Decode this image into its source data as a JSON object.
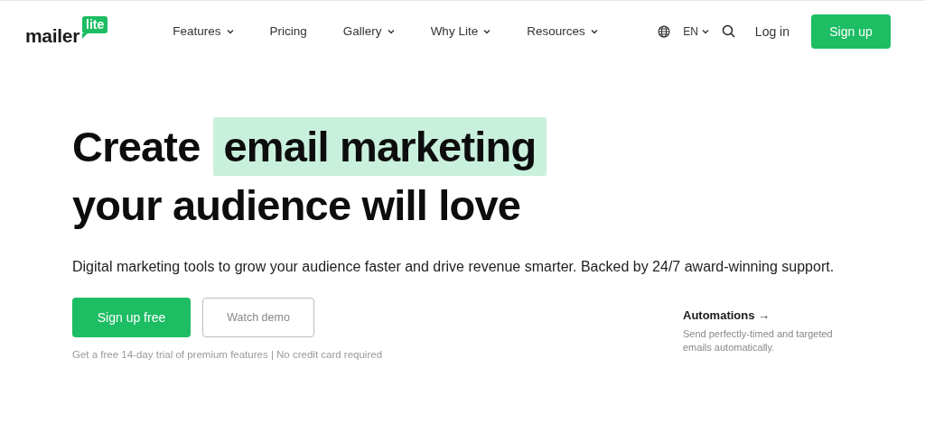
{
  "header": {
    "logo": {
      "word": "mailer",
      "badge": "lite"
    },
    "nav": [
      {
        "label": "Features",
        "has_menu": true
      },
      {
        "label": "Pricing",
        "has_menu": false
      },
      {
        "label": "Gallery",
        "has_menu": true
      },
      {
        "label": "Why Lite",
        "has_menu": true
      },
      {
        "label": "Resources",
        "has_menu": true
      }
    ],
    "language": "EN",
    "login": "Log in",
    "signup": "Sign up"
  },
  "hero": {
    "title_lines": [
      [
        {
          "text": "Create",
          "highlighted": false
        },
        {
          "text": "email marketing",
          "highlighted": true
        }
      ],
      [
        {
          "text": "your audience will love",
          "highlighted": false
        }
      ]
    ],
    "subtitle": "Digital marketing tools to grow your audience faster and drive revenue smarter. Backed by 24/7 award-winning support.",
    "primary_button": "Sign up free",
    "secondary_button": "Watch demo",
    "note": "Get a free 14-day trial of premium features | No credit card required"
  },
  "feature_card": {
    "title": "Automations →",
    "text": "Send perfectly-timed and targeted emails automatically."
  }
}
